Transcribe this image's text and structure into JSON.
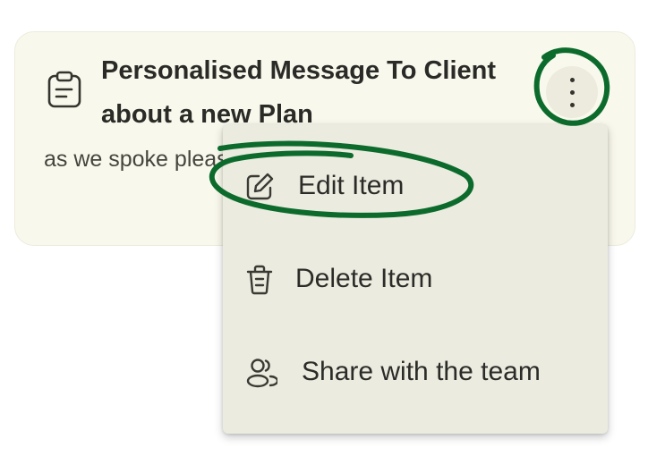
{
  "card": {
    "icon": "clipboard-icon",
    "title": "Personalised Message To Client about a new Plan",
    "body": "as we spoke please find the attached document, also",
    "more_icon": "more-vertical-icon"
  },
  "menu": {
    "items": [
      {
        "label": "Edit Item",
        "icon": "pencil-edit-icon"
      },
      {
        "label": "Delete Item",
        "icon": "trash-icon"
      },
      {
        "label": "Share with the team",
        "icon": "users-icon"
      }
    ]
  },
  "colors": {
    "card_background": "#f9f8ec",
    "menu_background": "#ecebdf",
    "annotation_green": "#0c6b2c",
    "text": "#2b2b28"
  }
}
